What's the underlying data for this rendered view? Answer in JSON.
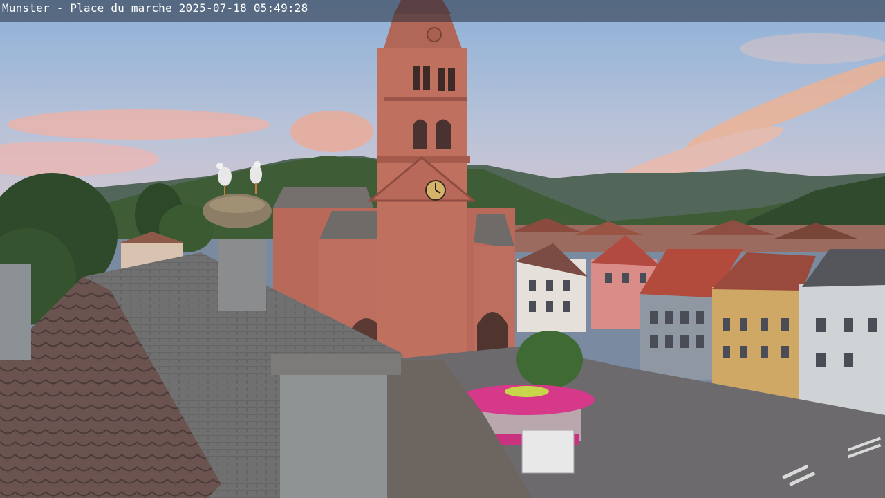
{
  "overlay": {
    "caption": "Munster - Place du marche 2025-07-18 05:49:28"
  },
  "scene": {
    "description_icons": [
      "church-tower",
      "storks-nest",
      "tiled-roof",
      "chimney",
      "pink-kiosk",
      "town-houses",
      "mountains"
    ]
  },
  "colors": {
    "sky_top": "#8fb0d6",
    "sky_bottom": "#c9c9d8",
    "cloud_pink": "#f3a98e",
    "sandstone": "#b56a5b",
    "kiosk": "#d6398a",
    "roof_slate": "#6b6b70"
  }
}
